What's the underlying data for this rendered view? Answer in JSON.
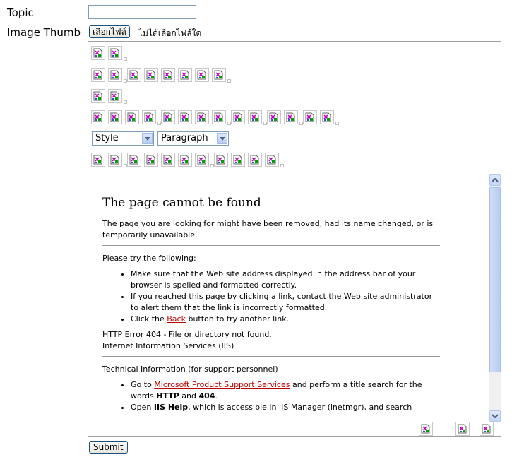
{
  "form": {
    "topic_label": "Topic",
    "thumb_label": "Image Thumb",
    "file_button": "เลือกไฟล์",
    "file_status": "ไม่ได้เลือกไฟล์ใด",
    "submit_label": "Submit"
  },
  "editor": {
    "toolbar": {
      "style_select": "Style",
      "format_select": "Paragraph"
    },
    "content": {
      "heading": "The page cannot be found",
      "intro": "The page you are looking for might have been removed, had its name changed, or is temporarily unavailable.",
      "try_heading": "Please try the following:",
      "tips": {
        "tip1": "Make sure that the Web site address displayed in the address bar of your browser is spelled and formatted correctly.",
        "tip2": "If you reached this page by clicking a link, contact the Web site administrator to alert them that the link is incorrectly formatted.",
        "tip3_before": "Click the ",
        "tip3_link": "Back",
        "tip3_after": " button to try another link."
      },
      "error_line1": "HTTP Error 404 - File or directory not found.",
      "error_line2": "Internet Information Services (IIS)",
      "tech_heading": "Technical Information (for support personnel)",
      "tech1_before": "Go to ",
      "tech1_link": "Microsoft Product Support Services",
      "tech1_mid": " and perform a title search for the words ",
      "tech1_b1": "HTTP",
      "tech1_and": " and ",
      "tech1_b2": "404",
      "tech1_end": ".",
      "tech2_before": "Open ",
      "tech2_bold": "IIS Help",
      "tech2_after": ", which is accessible in IIS Manager (inetmgr), and search"
    }
  },
  "icons": {
    "toolbar_button": "broken-image-icon"
  },
  "colors": {
    "link": "#c00000",
    "scrollbar": "#c2d5f7"
  }
}
